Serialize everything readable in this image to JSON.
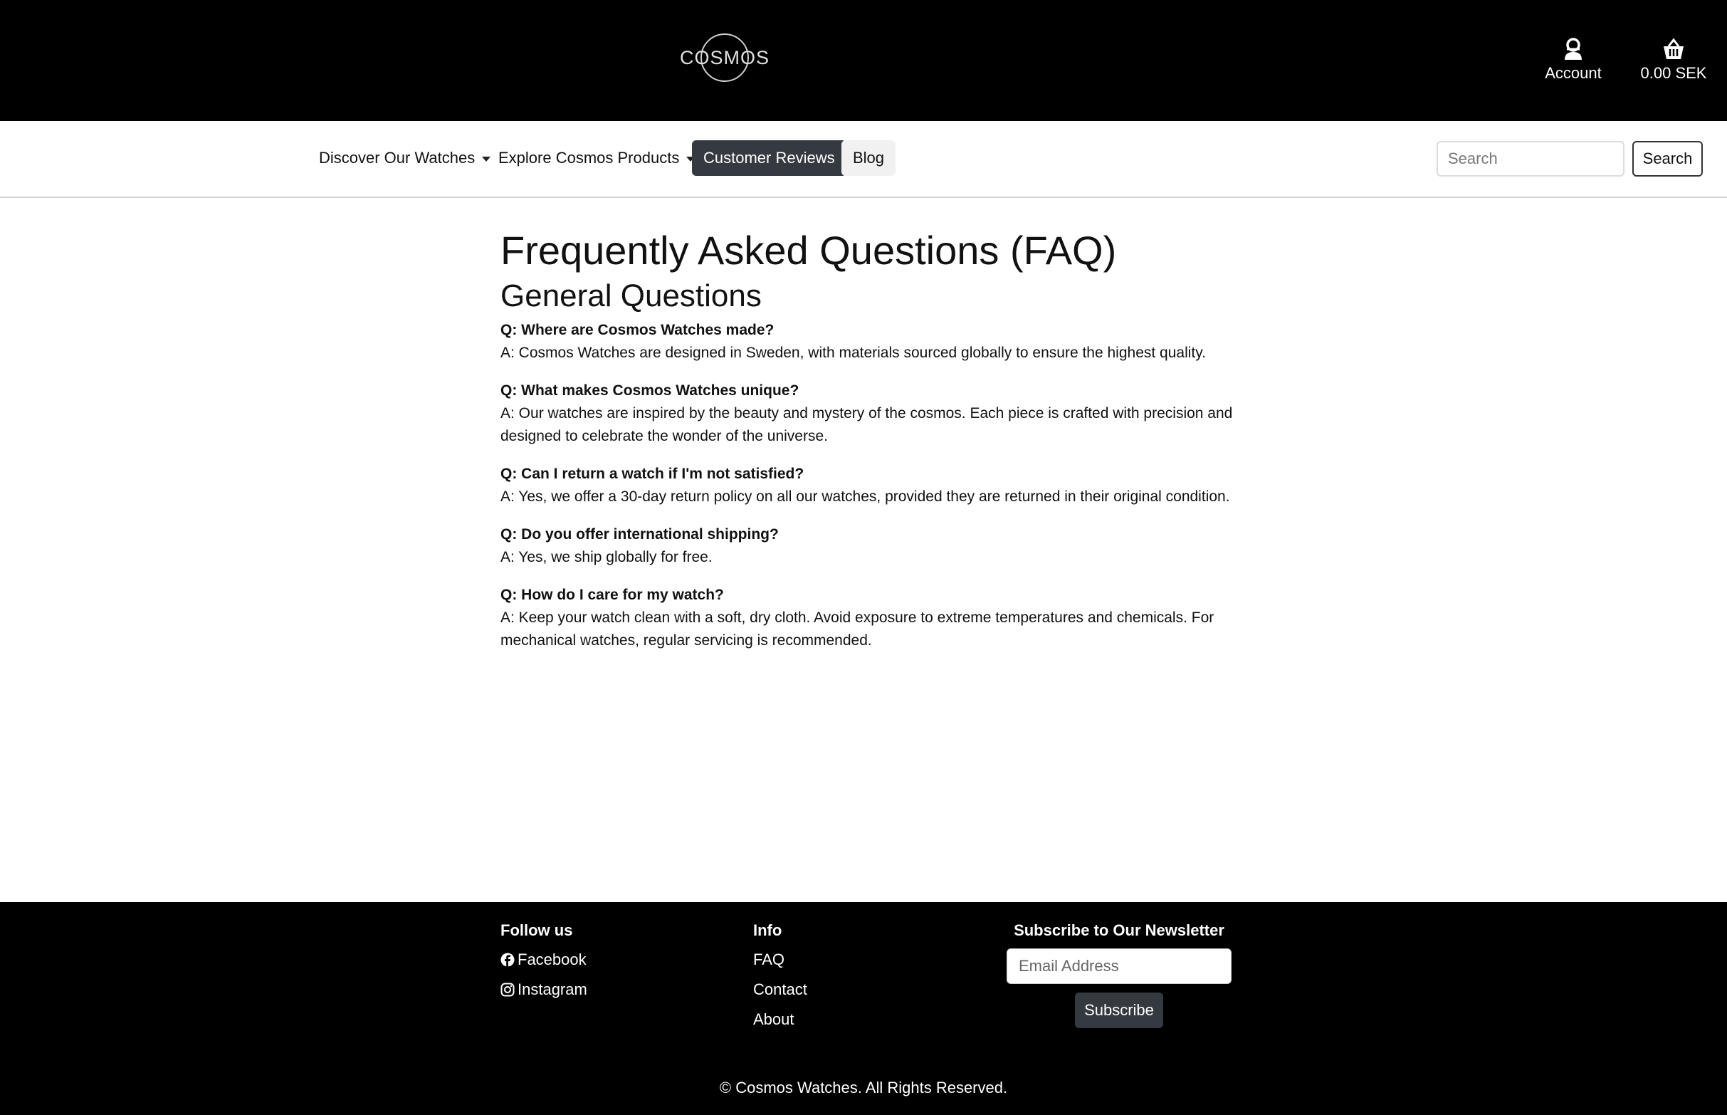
{
  "header": {
    "logo_text": "COSMOS",
    "account_label": "Account",
    "cart_total": "0.00 SEK",
    "icons": [
      "user-icon",
      "basket-icon"
    ]
  },
  "nav": {
    "items": [
      {
        "label": "Discover Our Watches",
        "dropdown": true
      },
      {
        "label": "Explore Cosmos Products",
        "dropdown": true
      },
      {
        "label": "Customer Reviews",
        "active": true
      },
      {
        "label": "Blog"
      }
    ],
    "search_placeholder": "Search",
    "search_button": "Search"
  },
  "page": {
    "title": "Frequently Asked Questions (FAQ)",
    "section_title": "General Questions",
    "faqs": [
      {
        "q": "Q: Where are Cosmos Watches made?",
        "a": "A: Cosmos Watches are designed in Sweden, with materials sourced globally to ensure the highest quality."
      },
      {
        "q": "Q: What makes Cosmos Watches unique?",
        "a": "A: Our watches are inspired by the beauty and mystery of the cosmos. Each piece is crafted with precision and designed to celebrate the wonder of the universe."
      },
      {
        "q": "Q: Can I return a watch if I'm not satisfied?",
        "a": "A: Yes, we offer a 30-day return policy on all our watches, provided they are returned in their original condition."
      },
      {
        "q": "Q: Do you offer international shipping?",
        "a": "A: Yes, we ship globally for free."
      },
      {
        "q": "Q: How do I care for my watch?",
        "a": "A: Keep your watch clean with a soft, dry cloth. Avoid exposure to extreme temperatures and chemicals. For mechanical watches, regular servicing is recommended."
      }
    ]
  },
  "footer": {
    "follow_heading": "Follow us",
    "social": [
      {
        "label": "Facebook",
        "icon": "facebook-icon"
      },
      {
        "label": "Instagram",
        "icon": "instagram-icon"
      }
    ],
    "info_heading": "Info",
    "info_links": [
      "FAQ",
      "Contact",
      "About"
    ],
    "newsletter_heading": "Subscribe to Our Newsletter",
    "email_placeholder": "Email Address",
    "subscribe_button": "Subscribe",
    "copyright": "© Cosmos Watches. All Rights Reserved."
  },
  "colors": {
    "header_bg": "#000000",
    "footer_bg": "#000000",
    "active_nav_bg": "#343a40",
    "subscribe_bg": "#343a40"
  }
}
